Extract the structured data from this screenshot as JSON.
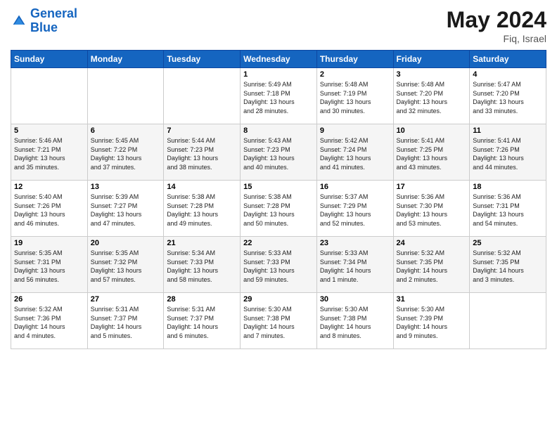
{
  "header": {
    "logo_line1": "General",
    "logo_line2": "Blue",
    "month_year": "May 2024",
    "location": "Fiq, Israel"
  },
  "weekdays": [
    "Sunday",
    "Monday",
    "Tuesday",
    "Wednesday",
    "Thursday",
    "Friday",
    "Saturday"
  ],
  "weeks": [
    [
      {
        "day": "",
        "info": ""
      },
      {
        "day": "",
        "info": ""
      },
      {
        "day": "",
        "info": ""
      },
      {
        "day": "1",
        "info": "Sunrise: 5:49 AM\nSunset: 7:18 PM\nDaylight: 13 hours\nand 28 minutes."
      },
      {
        "day": "2",
        "info": "Sunrise: 5:48 AM\nSunset: 7:19 PM\nDaylight: 13 hours\nand 30 minutes."
      },
      {
        "day": "3",
        "info": "Sunrise: 5:48 AM\nSunset: 7:20 PM\nDaylight: 13 hours\nand 32 minutes."
      },
      {
        "day": "4",
        "info": "Sunrise: 5:47 AM\nSunset: 7:20 PM\nDaylight: 13 hours\nand 33 minutes."
      }
    ],
    [
      {
        "day": "5",
        "info": "Sunrise: 5:46 AM\nSunset: 7:21 PM\nDaylight: 13 hours\nand 35 minutes."
      },
      {
        "day": "6",
        "info": "Sunrise: 5:45 AM\nSunset: 7:22 PM\nDaylight: 13 hours\nand 37 minutes."
      },
      {
        "day": "7",
        "info": "Sunrise: 5:44 AM\nSunset: 7:23 PM\nDaylight: 13 hours\nand 38 minutes."
      },
      {
        "day": "8",
        "info": "Sunrise: 5:43 AM\nSunset: 7:23 PM\nDaylight: 13 hours\nand 40 minutes."
      },
      {
        "day": "9",
        "info": "Sunrise: 5:42 AM\nSunset: 7:24 PM\nDaylight: 13 hours\nand 41 minutes."
      },
      {
        "day": "10",
        "info": "Sunrise: 5:41 AM\nSunset: 7:25 PM\nDaylight: 13 hours\nand 43 minutes."
      },
      {
        "day": "11",
        "info": "Sunrise: 5:41 AM\nSunset: 7:26 PM\nDaylight: 13 hours\nand 44 minutes."
      }
    ],
    [
      {
        "day": "12",
        "info": "Sunrise: 5:40 AM\nSunset: 7:26 PM\nDaylight: 13 hours\nand 46 minutes."
      },
      {
        "day": "13",
        "info": "Sunrise: 5:39 AM\nSunset: 7:27 PM\nDaylight: 13 hours\nand 47 minutes."
      },
      {
        "day": "14",
        "info": "Sunrise: 5:38 AM\nSunset: 7:28 PM\nDaylight: 13 hours\nand 49 minutes."
      },
      {
        "day": "15",
        "info": "Sunrise: 5:38 AM\nSunset: 7:28 PM\nDaylight: 13 hours\nand 50 minutes."
      },
      {
        "day": "16",
        "info": "Sunrise: 5:37 AM\nSunset: 7:29 PM\nDaylight: 13 hours\nand 52 minutes."
      },
      {
        "day": "17",
        "info": "Sunrise: 5:36 AM\nSunset: 7:30 PM\nDaylight: 13 hours\nand 53 minutes."
      },
      {
        "day": "18",
        "info": "Sunrise: 5:36 AM\nSunset: 7:31 PM\nDaylight: 13 hours\nand 54 minutes."
      }
    ],
    [
      {
        "day": "19",
        "info": "Sunrise: 5:35 AM\nSunset: 7:31 PM\nDaylight: 13 hours\nand 56 minutes."
      },
      {
        "day": "20",
        "info": "Sunrise: 5:35 AM\nSunset: 7:32 PM\nDaylight: 13 hours\nand 57 minutes."
      },
      {
        "day": "21",
        "info": "Sunrise: 5:34 AM\nSunset: 7:33 PM\nDaylight: 13 hours\nand 58 minutes."
      },
      {
        "day": "22",
        "info": "Sunrise: 5:33 AM\nSunset: 7:33 PM\nDaylight: 13 hours\nand 59 minutes."
      },
      {
        "day": "23",
        "info": "Sunrise: 5:33 AM\nSunset: 7:34 PM\nDaylight: 14 hours\nand 1 minute."
      },
      {
        "day": "24",
        "info": "Sunrise: 5:32 AM\nSunset: 7:35 PM\nDaylight: 14 hours\nand 2 minutes."
      },
      {
        "day": "25",
        "info": "Sunrise: 5:32 AM\nSunset: 7:35 PM\nDaylight: 14 hours\nand 3 minutes."
      }
    ],
    [
      {
        "day": "26",
        "info": "Sunrise: 5:32 AM\nSunset: 7:36 PM\nDaylight: 14 hours\nand 4 minutes."
      },
      {
        "day": "27",
        "info": "Sunrise: 5:31 AM\nSunset: 7:37 PM\nDaylight: 14 hours\nand 5 minutes."
      },
      {
        "day": "28",
        "info": "Sunrise: 5:31 AM\nSunset: 7:37 PM\nDaylight: 14 hours\nand 6 minutes."
      },
      {
        "day": "29",
        "info": "Sunrise: 5:30 AM\nSunset: 7:38 PM\nDaylight: 14 hours\nand 7 minutes."
      },
      {
        "day": "30",
        "info": "Sunrise: 5:30 AM\nSunset: 7:38 PM\nDaylight: 14 hours\nand 8 minutes."
      },
      {
        "day": "31",
        "info": "Sunrise: 5:30 AM\nSunset: 7:39 PM\nDaylight: 14 hours\nand 9 minutes."
      },
      {
        "day": "",
        "info": ""
      }
    ]
  ]
}
